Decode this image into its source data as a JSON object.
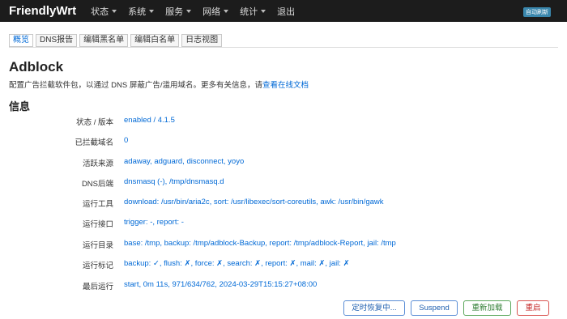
{
  "navbar": {
    "brand": "FriendlyWrt",
    "menu": [
      {
        "label": "状态",
        "caret": true
      },
      {
        "label": "系统",
        "caret": true
      },
      {
        "label": "服务",
        "caret": true
      },
      {
        "label": "网络",
        "caret": true
      },
      {
        "label": "统计",
        "caret": true
      },
      {
        "label": "退出",
        "caret": false
      }
    ],
    "badge": "自动刷新"
  },
  "tabs": [
    {
      "label": "概览",
      "active": true
    },
    {
      "label": "DNS报告",
      "active": false
    },
    {
      "label": "编辑黑名单",
      "active": false
    },
    {
      "label": "编辑白名单",
      "active": false
    },
    {
      "label": "日志视图",
      "active": false
    }
  ],
  "page": {
    "title": "Adblock",
    "description_prefix": "配置广告拦截软件包，以通过 DNS 屏蔽广告/滥用域名。更多有关信息，请",
    "description_link": "查看在线文档",
    "section_title": "信息"
  },
  "info": [
    {
      "label": "状态 / 版本",
      "value": "enabled / 4.1.5"
    },
    {
      "label": "已拦截域名",
      "value": "0"
    },
    {
      "label": "活跃来源",
      "value": "adaway, adguard, disconnect, yoyo"
    },
    {
      "label": "DNS后端",
      "value": "dnsmasq (-), /tmp/dnsmasq.d"
    },
    {
      "label": "运行工具",
      "value": "download: /usr/bin/aria2c, sort: /usr/libexec/sort-coreutils, awk: /usr/bin/gawk"
    },
    {
      "label": "运行接口",
      "value": "trigger: -, report: -"
    },
    {
      "label": "运行目录",
      "value": "base: /tmp, backup: /tmp/adblock-Backup, report: /tmp/adblock-Report, jail: /tmp"
    },
    {
      "label": "运行标记",
      "value": "backup: ✓, flush: ✗, force: ✗, search: ✗, report: ✗, mail: ✗, jail: ✗"
    },
    {
      "label": "最后运行",
      "value": "start, 0m 11s, 971/634/762, 2024-03-29T15:15:27+08:00"
    }
  ],
  "buttons": {
    "timer": "定时恢复中...",
    "suspend": "Suspend",
    "reload": "重新加载",
    "restart": "重启"
  }
}
